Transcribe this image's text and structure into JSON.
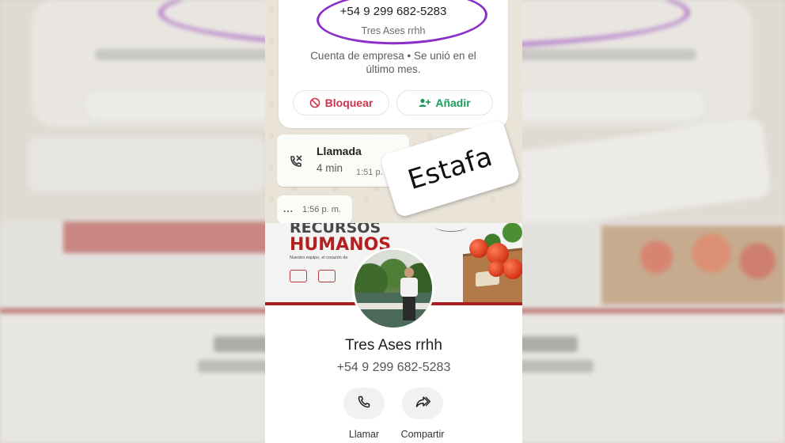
{
  "contact_card": {
    "phone": "+54 9 299 682-5283",
    "name": "Tres Ases rrhh",
    "description": "Cuenta de empresa • Se unió en el último mes.",
    "block_label": "Bloquear",
    "add_label": "Añadir"
  },
  "chat": {
    "call_title": "Llamada",
    "call_duration": "4 min",
    "call_time": "1:51 p. m.",
    "message_dots": "...",
    "message_time": "1:56 p. m."
  },
  "sticker": {
    "text": "Estafa"
  },
  "banner": {
    "line1": "RECURSOS",
    "line2": "HUMANOS",
    "subtitle": "Nuestro equipo, el corazón de"
  },
  "profile": {
    "name": "Tres Ases rrhh",
    "phone": "+54 9 299 682-5283",
    "call_label": "Llamar",
    "share_label": "Compartir"
  },
  "colors": {
    "highlight": "#8b2fc9",
    "block": "#d0324b",
    "add": "#1b9a57",
    "banner_red": "#b42020"
  }
}
